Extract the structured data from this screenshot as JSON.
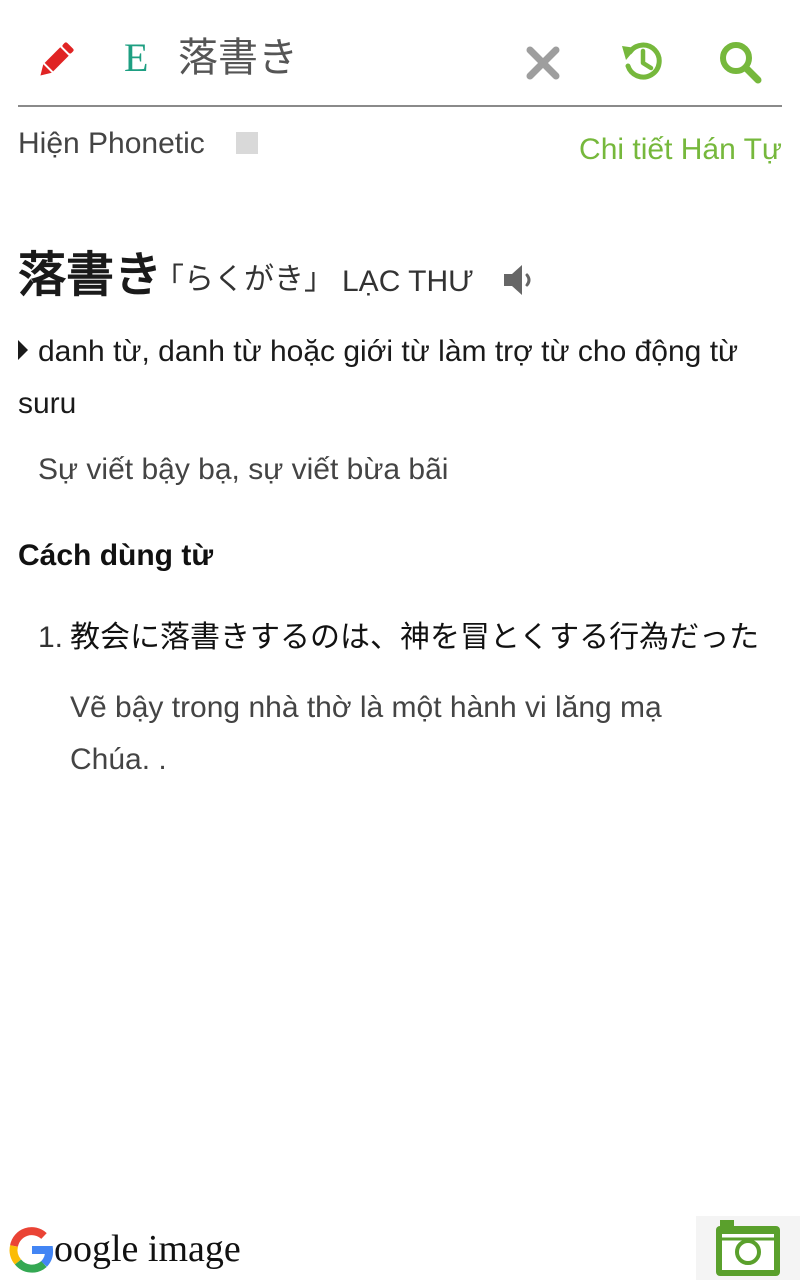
{
  "header": {
    "language_badge": "E",
    "search_query": "落書き"
  },
  "options": {
    "phonetic_label": "Hiện Phonetic",
    "kanji_detail_link": "Chi tiết Hán Tự"
  },
  "entry": {
    "word": "落書き",
    "reading": "「らくがき」",
    "han_viet": "LẠC THƯ",
    "part_of_speech": "danh từ, danh từ hoặc giới từ làm trợ từ cho động từ suru",
    "meaning": "Sự viết bậy bạ, sự viết bừa bãi"
  },
  "usage": {
    "title": "Cách dùng từ",
    "examples": [
      {
        "number": "1.",
        "japanese": "教会に落書きするのは、神を冒とくする行為だった",
        "vietnamese": "Vẽ bậy trong nhà thờ là một hành vi lăng mạ Chúa. ."
      }
    ]
  },
  "footer": {
    "google_image_label": "oogle image"
  },
  "colors": {
    "accent_green": "#76b83c",
    "badge_teal": "#1e9f82",
    "pencil_red": "#e02424"
  },
  "icons": [
    "pencil-icon",
    "clear-icon",
    "history-icon",
    "search-icon",
    "speaker-icon",
    "google-g-icon",
    "camera-icon"
  ]
}
